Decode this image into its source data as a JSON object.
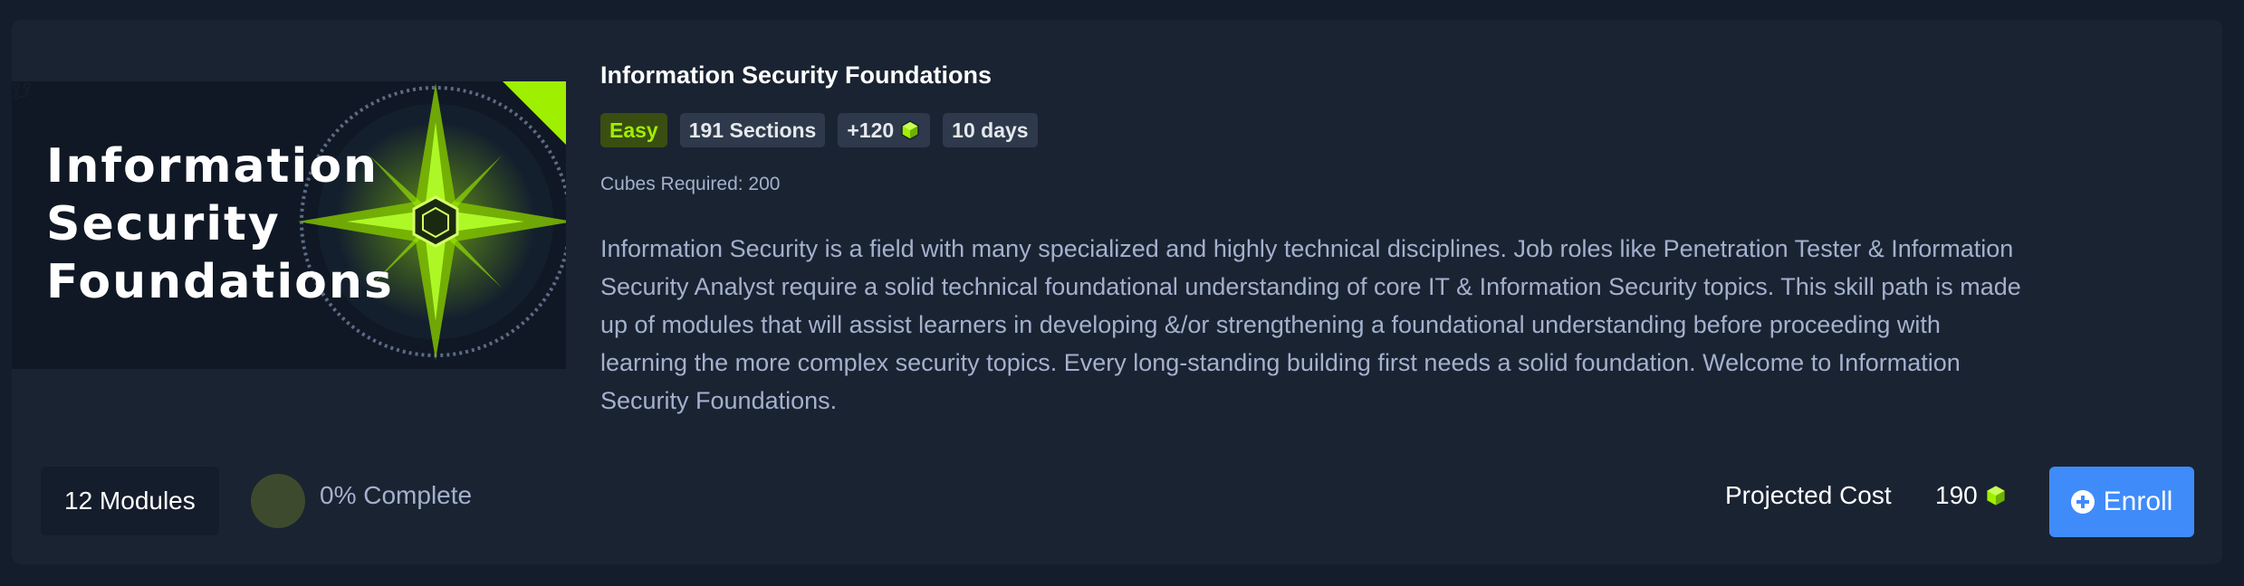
{
  "course": {
    "thumbnail_title": "Information Security Foundations",
    "title": "Information Security Foundations",
    "tags": {
      "difficulty": "Easy",
      "sections": "191 Sections",
      "cubes_reward": "+120",
      "duration": "10 days"
    },
    "cubes_required": "Cubes Required: 200",
    "description": "Information Security is a field with many specialized and highly technical disciplines. Job roles like Penetration Tester & Information Security Analyst require a solid technical foundational understanding of core IT & Information Security topics. This skill path is made up of modules that will assist learners in developing &/or strengthening a foundational understanding before proceeding with learning the more complex security topics. Every long-standing building first needs a solid foundation. Welcome to Information Security Foundations."
  },
  "footer": {
    "modules": "12 Modules",
    "progress": "0% Complete",
    "progress_value": 0,
    "projected_cost_label": "Projected Cost",
    "projected_cost_value": "190",
    "enroll_label": "Enroll"
  },
  "colors": {
    "accent_green": "#9fef00",
    "button_blue": "#3f8bfa",
    "background": "#141d2b",
    "card": "#1a2332"
  },
  "icons": [
    "cube-icon",
    "path-icon",
    "plus-circle-icon"
  ]
}
